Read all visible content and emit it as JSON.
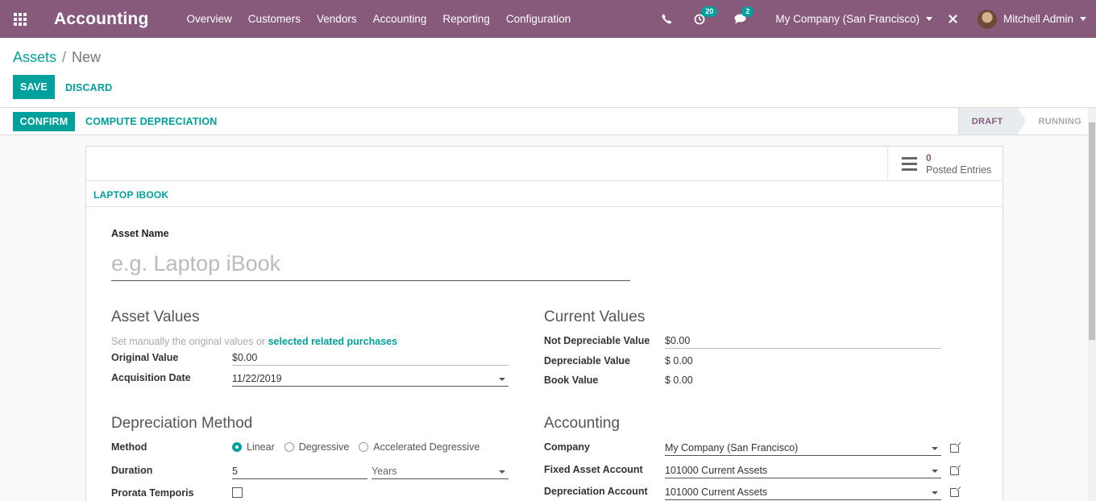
{
  "navbar": {
    "app_title": "Accounting",
    "menu": [
      "Overview",
      "Customers",
      "Vendors",
      "Accounting",
      "Reporting",
      "Configuration"
    ],
    "activity_count": "20",
    "messages_count": "2",
    "company": "My Company (San Francisco)",
    "user": "Mitchell Admin",
    "icons": [
      "apps-grid-icon",
      "phone-icon",
      "clock-icon",
      "chat-icon",
      "close-icon"
    ]
  },
  "breadcrumb": {
    "parent": "Assets",
    "separator": "/",
    "current": "New"
  },
  "buttons": {
    "save": "SAVE",
    "discard": "DISCARD",
    "confirm": "CONFIRM",
    "compute": "COMPUTE DEPRECIATION"
  },
  "stages": {
    "draft": "DRAFT",
    "running": "RUNNING",
    "active": "DRAFT"
  },
  "smart_button": {
    "value": "0",
    "label": "Posted Entries"
  },
  "model_name": "LAPTOP IBOOK",
  "asset_name": {
    "label": "Asset Name",
    "placeholder": "e.g. Laptop iBook",
    "value": ""
  },
  "asset_values": {
    "title": "Asset Values",
    "hint_prefix": "Set manually the original values or",
    "hint_link": "selected related purchases",
    "original_value_label": "Original Value",
    "original_value": "$0.00",
    "acquisition_date_label": "Acquisition Date",
    "acquisition_date": "11/22/2019"
  },
  "current_values": {
    "title": "Current Values",
    "not_depreciable_label": "Not Depreciable Value",
    "not_depreciable": "$0.00",
    "depreciable_label": "Depreciable Value",
    "depreciable": "$ 0.00",
    "book_value_label": "Book Value",
    "book_value": "$ 0.00"
  },
  "depreciation_method": {
    "title": "Depreciation Method",
    "method_label": "Method",
    "options": [
      "Linear",
      "Degressive",
      "Accelerated Degressive"
    ],
    "selected": "Linear",
    "duration_label": "Duration",
    "duration": "5",
    "duration_unit": "Years",
    "prorata_label": "Prorata Temporis",
    "prorata_checked": false
  },
  "accounting": {
    "title": "Accounting",
    "company_label": "Company",
    "company": "My Company (San Francisco)",
    "fixed_asset_label": "Fixed Asset Account",
    "fixed_asset": "101000 Current Assets",
    "depreciation_label": "Depreciation Account",
    "depreciation": "101000 Current Assets"
  },
  "colors": {
    "brand": "#875a7b",
    "accent": "#00a09d"
  }
}
